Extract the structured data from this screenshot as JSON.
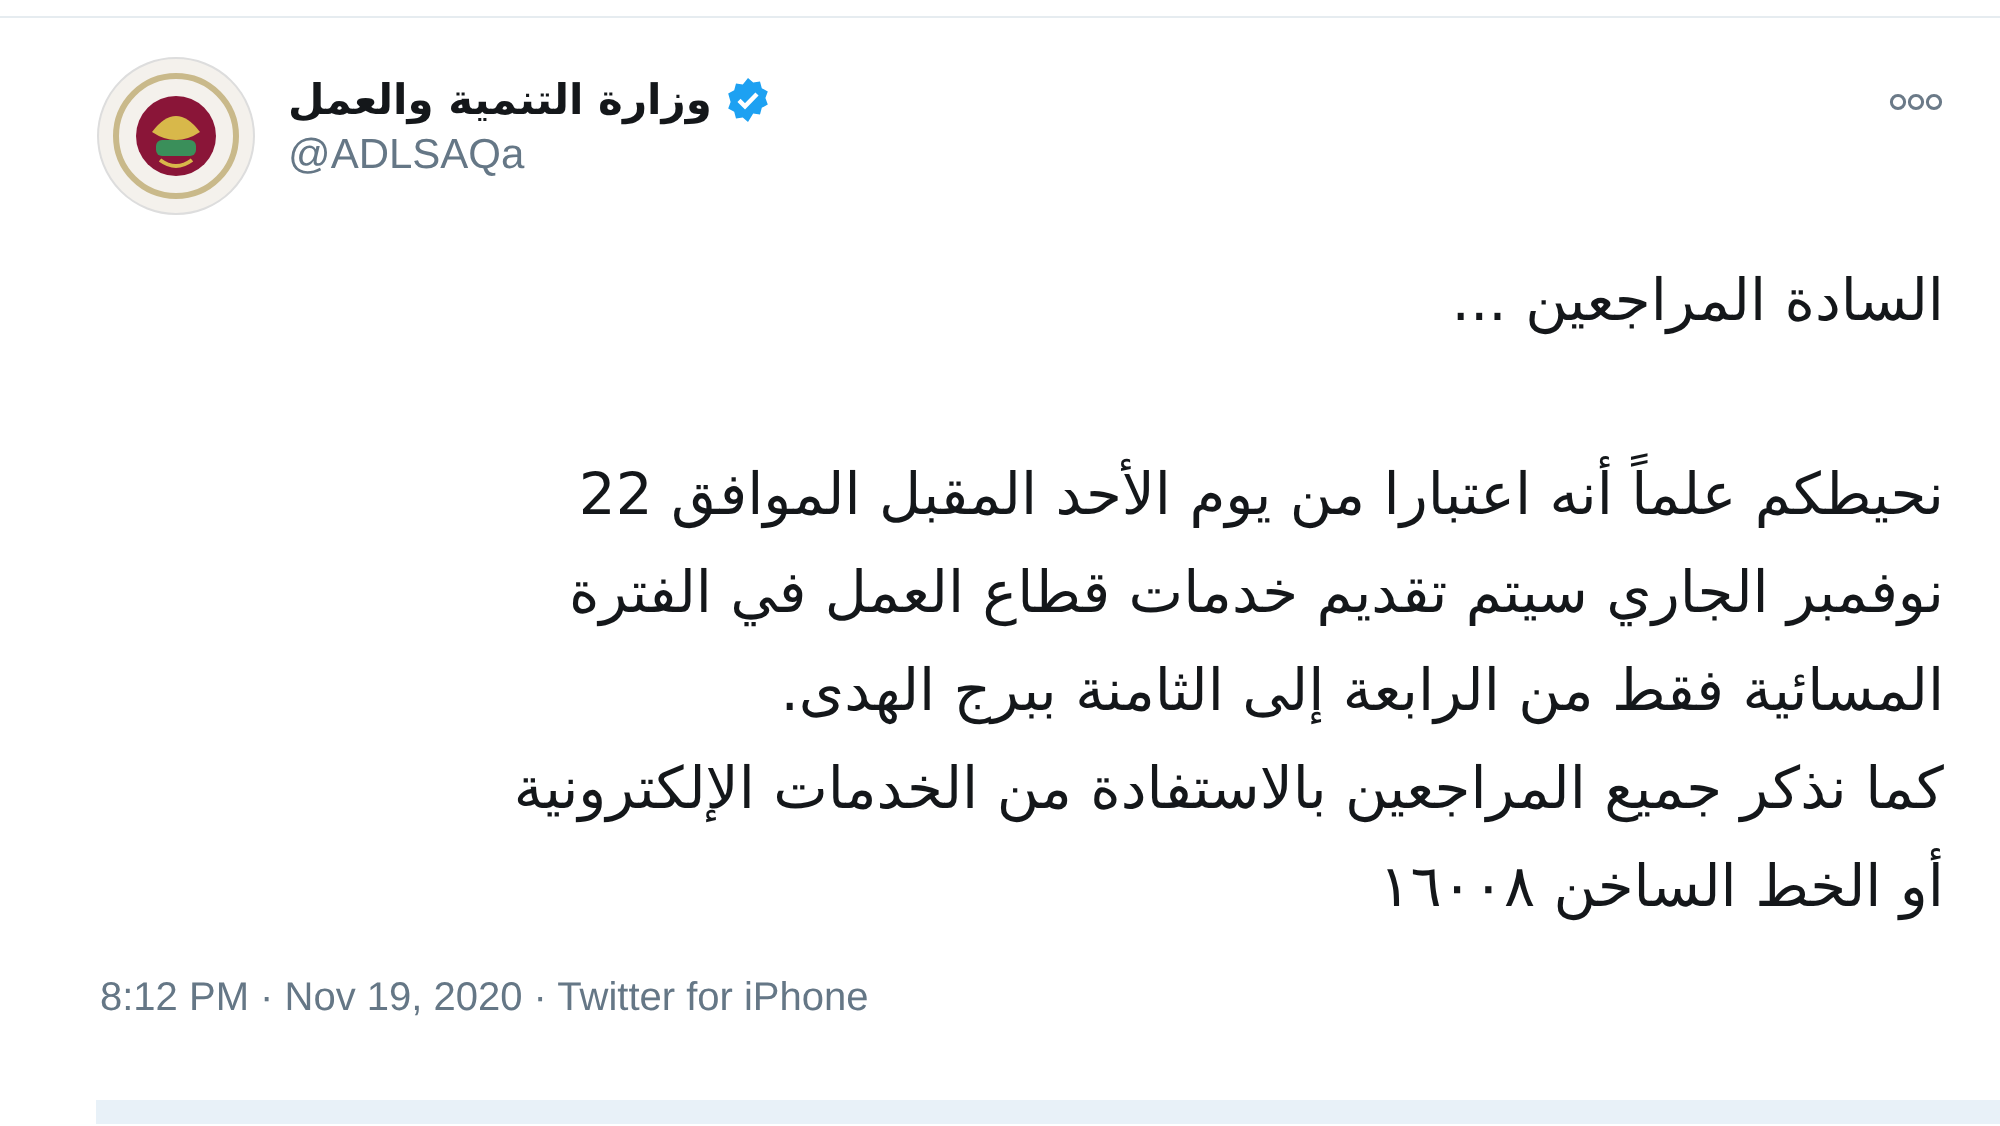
{
  "tweet": {
    "author": {
      "name": "وزارة التنمية والعمل",
      "verified": true,
      "handle": "@ADLSAQa"
    },
    "paragraphs": [
      {
        "lines": [
          "السادة المراجعين ..."
        ]
      },
      {
        "lines": [
          "نحيطكم علماً أنه اعتبارا من يوم الأحد المقبل الموافق 22",
          "نوفمبر الجاري سيتم تقديم خدمات قطاع العمل في الفترة",
          "المسائية فقط من الرابعة إلى الثامنة ببرج الهدى.",
          "كما نذكر جميع المراجعين بالاستفادة من الخدمات الإلكترونية",
          "أو الخط الساخن ١٦٠٠٨"
        ]
      }
    ],
    "meta": "8:12 PM · Nov 19, 2020 · Twitter for iPhone"
  }
}
